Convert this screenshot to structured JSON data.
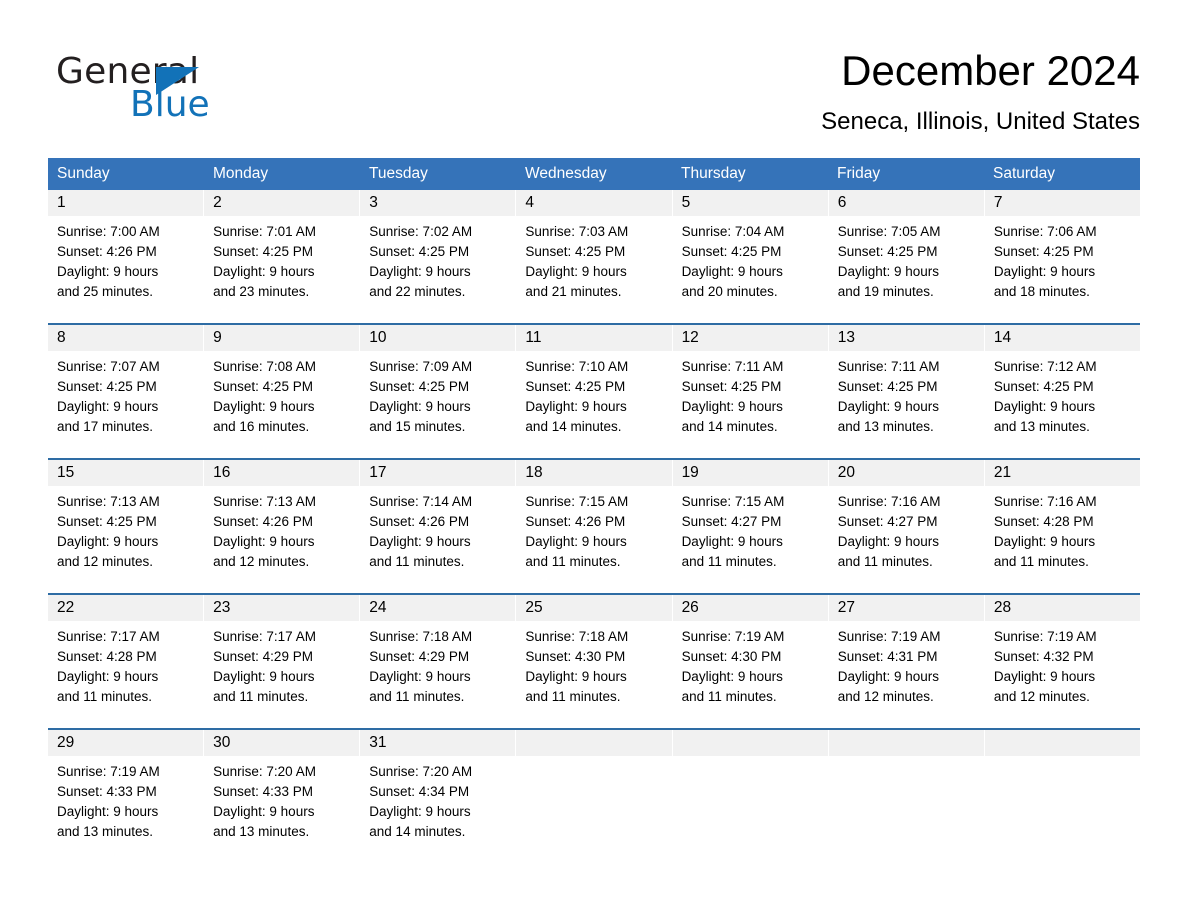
{
  "logo": {
    "word1": "General",
    "word2": "Blue",
    "triangle_color": "#1272b8"
  },
  "header": {
    "title": "December 2024",
    "location": "Seneca, Illinois, United States"
  },
  "colors": {
    "header_blue": "#3573b9",
    "row_divider_blue": "#2e6ca4",
    "day_band_gray": "#f1f1f1"
  },
  "weekdays": [
    "Sunday",
    "Monday",
    "Tuesday",
    "Wednesday",
    "Thursday",
    "Friday",
    "Saturday"
  ],
  "weeks": [
    [
      {
        "day": "1",
        "sunrise": "Sunrise: 7:00 AM",
        "sunset": "Sunset: 4:26 PM",
        "daylight1": "Daylight: 9 hours",
        "daylight2": "and 25 minutes."
      },
      {
        "day": "2",
        "sunrise": "Sunrise: 7:01 AM",
        "sunset": "Sunset: 4:25 PM",
        "daylight1": "Daylight: 9 hours",
        "daylight2": "and 23 minutes."
      },
      {
        "day": "3",
        "sunrise": "Sunrise: 7:02 AM",
        "sunset": "Sunset: 4:25 PM",
        "daylight1": "Daylight: 9 hours",
        "daylight2": "and 22 minutes."
      },
      {
        "day": "4",
        "sunrise": "Sunrise: 7:03 AM",
        "sunset": "Sunset: 4:25 PM",
        "daylight1": "Daylight: 9 hours",
        "daylight2": "and 21 minutes."
      },
      {
        "day": "5",
        "sunrise": "Sunrise: 7:04 AM",
        "sunset": "Sunset: 4:25 PM",
        "daylight1": "Daylight: 9 hours",
        "daylight2": "and 20 minutes."
      },
      {
        "day": "6",
        "sunrise": "Sunrise: 7:05 AM",
        "sunset": "Sunset: 4:25 PM",
        "daylight1": "Daylight: 9 hours",
        "daylight2": "and 19 minutes."
      },
      {
        "day": "7",
        "sunrise": "Sunrise: 7:06 AM",
        "sunset": "Sunset: 4:25 PM",
        "daylight1": "Daylight: 9 hours",
        "daylight2": "and 18 minutes."
      }
    ],
    [
      {
        "day": "8",
        "sunrise": "Sunrise: 7:07 AM",
        "sunset": "Sunset: 4:25 PM",
        "daylight1": "Daylight: 9 hours",
        "daylight2": "and 17 minutes."
      },
      {
        "day": "9",
        "sunrise": "Sunrise: 7:08 AM",
        "sunset": "Sunset: 4:25 PM",
        "daylight1": "Daylight: 9 hours",
        "daylight2": "and 16 minutes."
      },
      {
        "day": "10",
        "sunrise": "Sunrise: 7:09 AM",
        "sunset": "Sunset: 4:25 PM",
        "daylight1": "Daylight: 9 hours",
        "daylight2": "and 15 minutes."
      },
      {
        "day": "11",
        "sunrise": "Sunrise: 7:10 AM",
        "sunset": "Sunset: 4:25 PM",
        "daylight1": "Daylight: 9 hours",
        "daylight2": "and 14 minutes."
      },
      {
        "day": "12",
        "sunrise": "Sunrise: 7:11 AM",
        "sunset": "Sunset: 4:25 PM",
        "daylight1": "Daylight: 9 hours",
        "daylight2": "and 14 minutes."
      },
      {
        "day": "13",
        "sunrise": "Sunrise: 7:11 AM",
        "sunset": "Sunset: 4:25 PM",
        "daylight1": "Daylight: 9 hours",
        "daylight2": "and 13 minutes."
      },
      {
        "day": "14",
        "sunrise": "Sunrise: 7:12 AM",
        "sunset": "Sunset: 4:25 PM",
        "daylight1": "Daylight: 9 hours",
        "daylight2": "and 13 minutes."
      }
    ],
    [
      {
        "day": "15",
        "sunrise": "Sunrise: 7:13 AM",
        "sunset": "Sunset: 4:25 PM",
        "daylight1": "Daylight: 9 hours",
        "daylight2": "and 12 minutes."
      },
      {
        "day": "16",
        "sunrise": "Sunrise: 7:13 AM",
        "sunset": "Sunset: 4:26 PM",
        "daylight1": "Daylight: 9 hours",
        "daylight2": "and 12 minutes."
      },
      {
        "day": "17",
        "sunrise": "Sunrise: 7:14 AM",
        "sunset": "Sunset: 4:26 PM",
        "daylight1": "Daylight: 9 hours",
        "daylight2": "and 11 minutes."
      },
      {
        "day": "18",
        "sunrise": "Sunrise: 7:15 AM",
        "sunset": "Sunset: 4:26 PM",
        "daylight1": "Daylight: 9 hours",
        "daylight2": "and 11 minutes."
      },
      {
        "day": "19",
        "sunrise": "Sunrise: 7:15 AM",
        "sunset": "Sunset: 4:27 PM",
        "daylight1": "Daylight: 9 hours",
        "daylight2": "and 11 minutes."
      },
      {
        "day": "20",
        "sunrise": "Sunrise: 7:16 AM",
        "sunset": "Sunset: 4:27 PM",
        "daylight1": "Daylight: 9 hours",
        "daylight2": "and 11 minutes."
      },
      {
        "day": "21",
        "sunrise": "Sunrise: 7:16 AM",
        "sunset": "Sunset: 4:28 PM",
        "daylight1": "Daylight: 9 hours",
        "daylight2": "and 11 minutes."
      }
    ],
    [
      {
        "day": "22",
        "sunrise": "Sunrise: 7:17 AM",
        "sunset": "Sunset: 4:28 PM",
        "daylight1": "Daylight: 9 hours",
        "daylight2": "and 11 minutes."
      },
      {
        "day": "23",
        "sunrise": "Sunrise: 7:17 AM",
        "sunset": "Sunset: 4:29 PM",
        "daylight1": "Daylight: 9 hours",
        "daylight2": "and 11 minutes."
      },
      {
        "day": "24",
        "sunrise": "Sunrise: 7:18 AM",
        "sunset": "Sunset: 4:29 PM",
        "daylight1": "Daylight: 9 hours",
        "daylight2": "and 11 minutes."
      },
      {
        "day": "25",
        "sunrise": "Sunrise: 7:18 AM",
        "sunset": "Sunset: 4:30 PM",
        "daylight1": "Daylight: 9 hours",
        "daylight2": "and 11 minutes."
      },
      {
        "day": "26",
        "sunrise": "Sunrise: 7:19 AM",
        "sunset": "Sunset: 4:30 PM",
        "daylight1": "Daylight: 9 hours",
        "daylight2": "and 11 minutes."
      },
      {
        "day": "27",
        "sunrise": "Sunrise: 7:19 AM",
        "sunset": "Sunset: 4:31 PM",
        "daylight1": "Daylight: 9 hours",
        "daylight2": "and 12 minutes."
      },
      {
        "day": "28",
        "sunrise": "Sunrise: 7:19 AM",
        "sunset": "Sunset: 4:32 PM",
        "daylight1": "Daylight: 9 hours",
        "daylight2": "and 12 minutes."
      }
    ],
    [
      {
        "day": "29",
        "sunrise": "Sunrise: 7:19 AM",
        "sunset": "Sunset: 4:33 PM",
        "daylight1": "Daylight: 9 hours",
        "daylight2": "and 13 minutes."
      },
      {
        "day": "30",
        "sunrise": "Sunrise: 7:20 AM",
        "sunset": "Sunset: 4:33 PM",
        "daylight1": "Daylight: 9 hours",
        "daylight2": "and 13 minutes."
      },
      {
        "day": "31",
        "sunrise": "Sunrise: 7:20 AM",
        "sunset": "Sunset: 4:34 PM",
        "daylight1": "Daylight: 9 hours",
        "daylight2": "and 14 minutes."
      },
      {
        "day": "",
        "sunrise": "",
        "sunset": "",
        "daylight1": "",
        "daylight2": ""
      },
      {
        "day": "",
        "sunrise": "",
        "sunset": "",
        "daylight1": "",
        "daylight2": ""
      },
      {
        "day": "",
        "sunrise": "",
        "sunset": "",
        "daylight1": "",
        "daylight2": ""
      },
      {
        "day": "",
        "sunrise": "",
        "sunset": "",
        "daylight1": "",
        "daylight2": ""
      }
    ]
  ]
}
